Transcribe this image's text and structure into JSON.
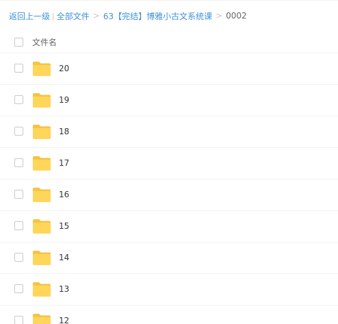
{
  "breadcrumb": {
    "back": "返回上一级",
    "divider": "|",
    "all_files": "全部文件",
    "sep1": ">",
    "folder_path": "63【完结】博雅小古文系统课",
    "sep2": ">",
    "current": "0002"
  },
  "table": {
    "header_label": "文件名",
    "rows": [
      {
        "name": "20",
        "icon": "folder-icon"
      },
      {
        "name": "19",
        "icon": "folder-icon"
      },
      {
        "name": "18",
        "icon": "folder-icon"
      },
      {
        "name": "17",
        "icon": "folder-icon"
      },
      {
        "name": "16",
        "icon": "folder-icon"
      },
      {
        "name": "15",
        "icon": "folder-icon"
      },
      {
        "name": "14",
        "icon": "folder-icon"
      },
      {
        "name": "13",
        "icon": "folder-icon"
      },
      {
        "name": "12",
        "icon": "folder-icon"
      }
    ]
  },
  "colors": {
    "link": "#3f93d8",
    "folder": "#ffd659",
    "folder_tab": "#f6c342"
  }
}
